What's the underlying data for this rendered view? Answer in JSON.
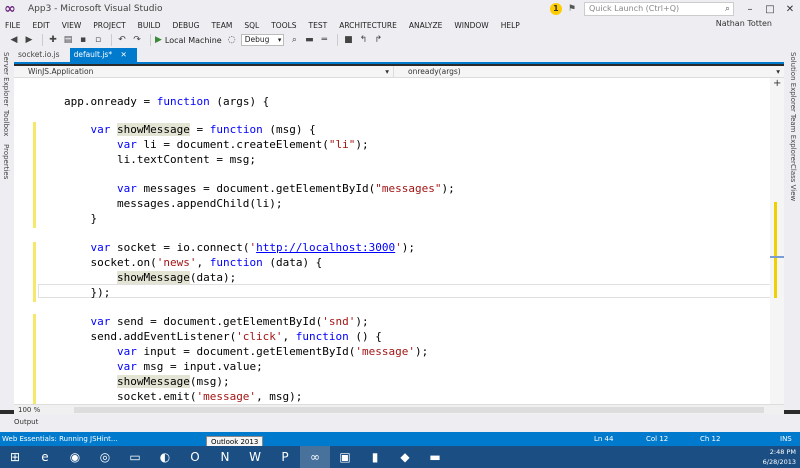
{
  "window": {
    "title": "App3 - Microsoft Visual Studio",
    "quick_launch_placeholder": "Quick Launch (Ctrl+Q)",
    "user": "Nathan Totten",
    "notification_count": "1"
  },
  "menu": [
    "FILE",
    "EDIT",
    "VIEW",
    "PROJECT",
    "BUILD",
    "DEBUG",
    "TEAM",
    "SQL",
    "TOOLS",
    "TEST",
    "ARCHITECTURE",
    "ANALYZE",
    "WINDOW",
    "HELP"
  ],
  "toolbar": {
    "run_label": "Local Machine",
    "config": "Debug"
  },
  "left_panels": [
    "Server Explorer",
    "Toolbox",
    "Properties"
  ],
  "right_panels": [
    "Solution Explorer",
    "Team Explorer",
    "Class View"
  ],
  "tabs": [
    {
      "label": "socket.io.js",
      "active": false
    },
    {
      "label": "default.js*",
      "active": true
    }
  ],
  "nav": {
    "scope": "WinJS.Application",
    "member": "onready(args)"
  },
  "code_lines": [
    "app.onready = function (args) {",
    "",
    "    var showMessage = function (msg) {",
    "        var li = document.createElement(\"li\");",
    "        li.textContent = msg;",
    "",
    "        var messages = document.getElementById(\"messages\");",
    "        messages.appendChild(li);",
    "    }",
    "",
    "    var socket = io.connect('http://localhost:3000');",
    "    socket.on('news', function (data) {",
    "        showMessage(data);",
    "    });",
    "",
    "    var send = document.getElementById('snd');",
    "    send.addEventListener('click', function () {",
    "        var input = document.getElementById('message');",
    "        var msg = input.value;",
    "        showMessage(msg);",
    "        socket.emit('message', msg);"
  ],
  "zoom": "100 %",
  "output_tab": "Output",
  "status": {
    "message": "Web Essentials: Running JSHint...",
    "ln": "Ln 44",
    "col": "Col 12",
    "ch": "Ch 12",
    "mode": "INS"
  },
  "taskbar": {
    "tooltip": "Outlook 2013",
    "time": "2:48 PM",
    "date": "6/28/2013",
    "apps": [
      "windows-start",
      "internet-explorer",
      "firefox",
      "chrome",
      "file-explorer",
      "media-player",
      "outlook",
      "onenote",
      "word",
      "powerpoint",
      "visual-studio",
      "photos",
      "files",
      "messaging",
      "terminal"
    ]
  }
}
